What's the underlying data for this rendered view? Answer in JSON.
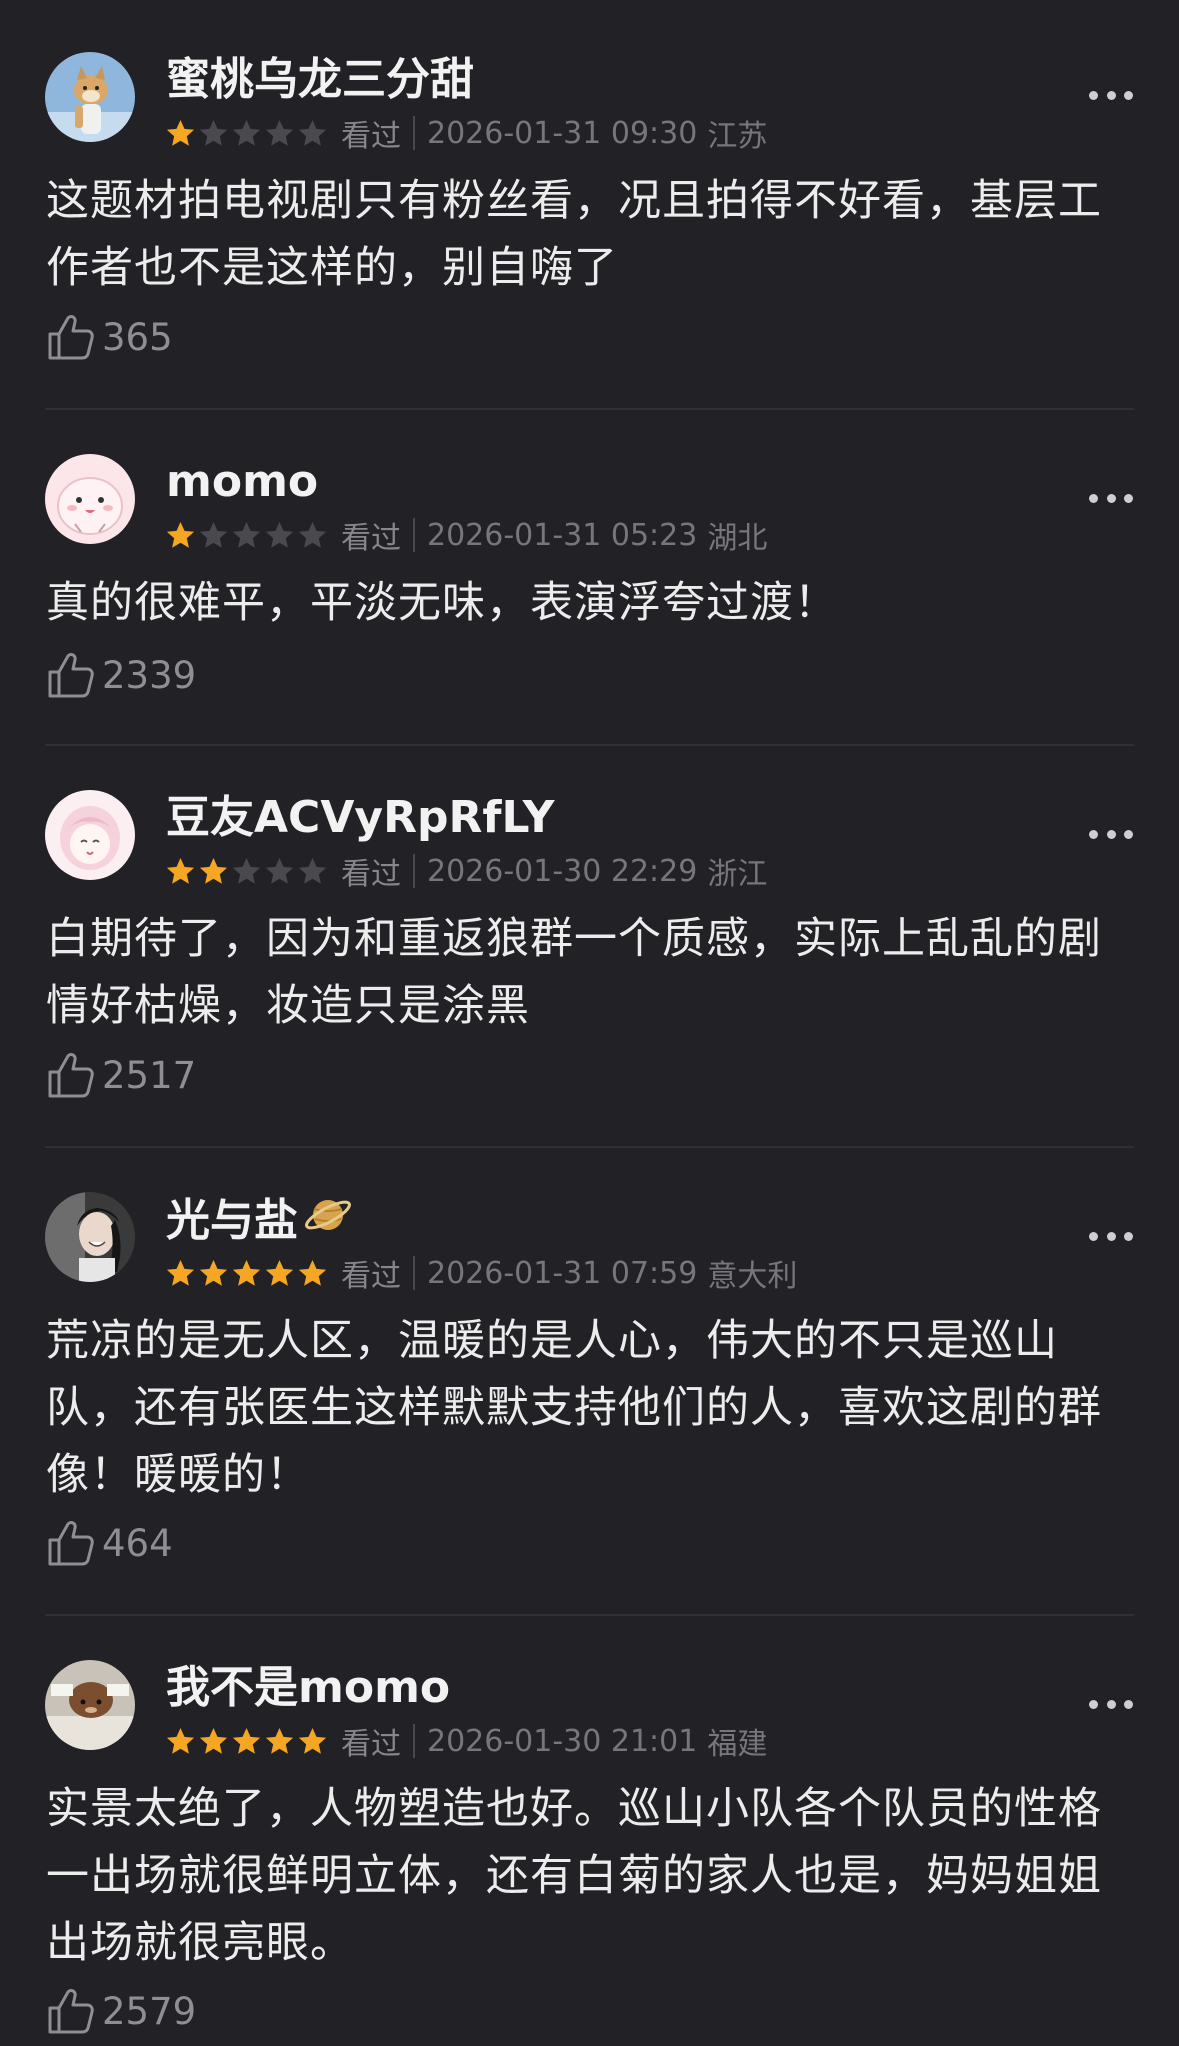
{
  "theme": {
    "background": "#222226",
    "star_filled": "#f5a623",
    "star_empty": "#4a4a4e",
    "text_primary": "#ececec",
    "text_secondary": "#76767b"
  },
  "reviews": [
    {
      "username": "蜜桃乌龙三分甜",
      "rating": 1,
      "watched_label": "看过",
      "time": "2026-01-31 09:30",
      "location": "江苏",
      "content": "这题材拍电视剧只有粉丝看，况且拍得不好看，基层工作者也不是这样的，别自嗨了",
      "likes": "365",
      "avatar": "avatar-shiba-icon"
    },
    {
      "username": "momo",
      "rating": 1,
      "watched_label": "看过",
      "time": "2026-01-31 05:23",
      "location": "湖北",
      "content": "真的很难平，平淡无味，表演浮夸过渡！",
      "likes": "2339",
      "avatar": "avatar-pink-blob-icon"
    },
    {
      "username": "豆友ACVyRpRfLY",
      "rating": 2,
      "watched_label": "看过",
      "time": "2026-01-30 22:29",
      "location": "浙江",
      "content": "白期待了，因为和重返狼群一个质感，实际上乱乱的剧情好枯燥，妆造只是涂黑",
      "likes": "2517",
      "avatar": "avatar-anime-girl-icon"
    },
    {
      "username": "光与盐",
      "badge": "saturn-emoji-icon",
      "rating": 5,
      "watched_label": "看过",
      "time": "2026-01-31 07:59",
      "location": "意大利",
      "content": "荒凉的是无人区，温暖的是人心，伟大的不只是巡山队，还有张医生这样默默支持他们的人，喜欢这剧的群像！暖暖的！",
      "likes": "464",
      "avatar": "avatar-smiling-person-icon"
    },
    {
      "username": "我不是momo",
      "rating": 5,
      "watched_label": "看过",
      "time": "2026-01-30 21:01",
      "location": "福建",
      "content": "实景太绝了，人物塑造也好。巡山小队各个队员的性格一出场就很鲜明立体，还有白菊的家人也是，妈妈姐姐出场就很亮眼。",
      "likes": "2579",
      "avatar": "avatar-cat-sign-icon"
    }
  ]
}
